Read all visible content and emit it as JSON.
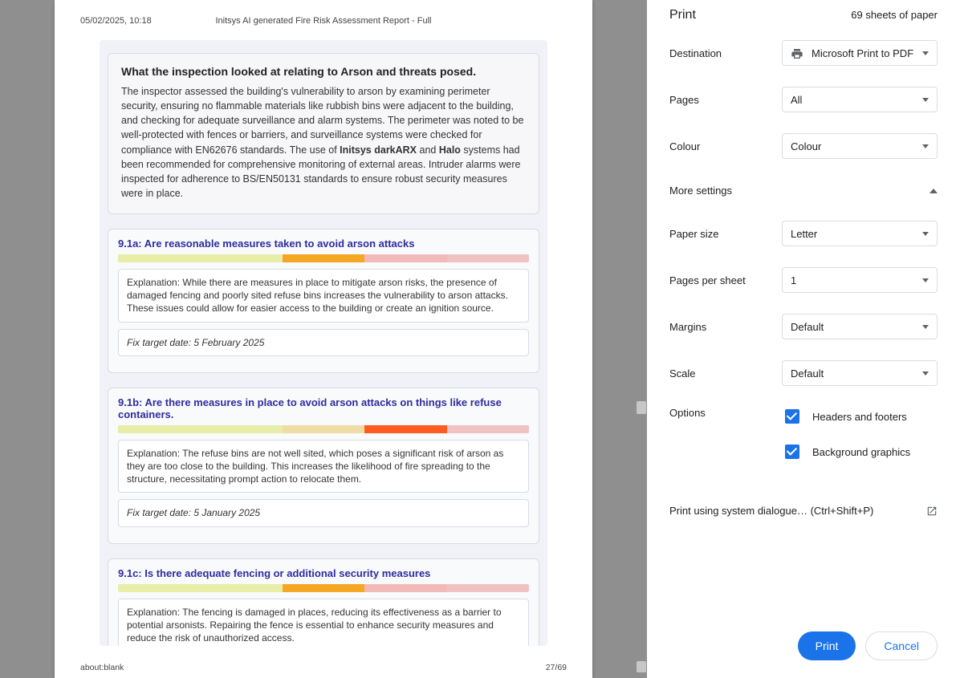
{
  "preview": {
    "header_left": "05/02/2025, 10:18",
    "header_center": "Initsys AI generated Fire Risk Assessment Report - Full",
    "footer_left": "about:blank",
    "footer_right": "27/69",
    "intro": {
      "title": "What the inspection looked at relating to Arson and threats posed.",
      "p1": "The inspector assessed the building's vulnerability to arson by examining perimeter security, ensuring no flammable materials like rubbish bins were adjacent to the building, and checking for adequate surveillance and alarm systems. The perimeter was noted to be well-protected with fences or barriers, and surveillance systems were checked for compliance with EN62676 standards. The use of ",
      "b1": "Initsys darkARX",
      "p2": " and ",
      "b2": "Halo",
      "p3": " systems had been recommended for comprehensive monitoring of external areas. Intruder alarms were inspected for adherence to BS/EN50131 standards to ensure robust security measures were in place."
    },
    "q91a": {
      "title": "9.1a: Are reasonable measures taken to avoid arson attacks",
      "exp": "Explanation: While there are measures in place to mitigate arson risks, the presence of damaged fencing and poorly sited refuse bins increases the vulnerability to arson attacks. These issues could allow for easier access to the building or create an ignition source.",
      "fix": "Fix target date: 5 February 2025"
    },
    "q91b": {
      "title": "9.1b: Are there measures in place to avoid arson attacks on things like refuse containers.",
      "exp": "Explanation: The refuse bins are not well sited, which poses a significant risk of arson as they are too close to the building. This increases the likelihood of fire spreading to the structure, necessitating prompt action to relocate them.",
      "fix": "Fix target date: 5 January 2025"
    },
    "q91c": {
      "title": "9.1c: Is there adequate fencing or additional security measures",
      "exp": "Explanation: The fencing is damaged in places, reducing its effectiveness as a barrier to potential arsonists. Repairing the fence is essential to enhance security measures and reduce the risk of unauthorized access."
    }
  },
  "panel": {
    "title": "Print",
    "sheets": "69 sheets of paper",
    "rows": {
      "destination_label": "Destination",
      "destination_value": "Microsoft Print to PDF",
      "pages_label": "Pages",
      "pages_value": "All",
      "colour_label": "Colour",
      "colour_value": "Colour",
      "more_settings": "More settings",
      "paper_size_label": "Paper size",
      "paper_size_value": "Letter",
      "pps_label": "Pages per sheet",
      "pps_value": "1",
      "margins_label": "Margins",
      "margins_value": "Default",
      "scale_label": "Scale",
      "scale_value": "Default",
      "options_label": "Options",
      "opt_headers": "Headers and footers",
      "opt_bg": "Background graphics",
      "sys_dialog": "Print using system dialogue… (Ctrl+Shift+P)"
    },
    "buttons": {
      "print": "Print",
      "cancel": "Cancel"
    }
  }
}
